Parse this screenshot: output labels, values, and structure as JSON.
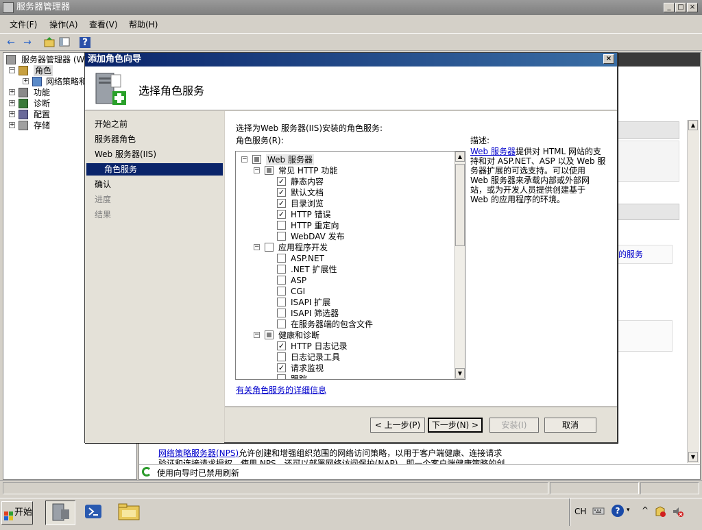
{
  "window": {
    "title": "服务器管理器",
    "controls": {
      "minimize": "_",
      "maximize": "□",
      "close": "×"
    }
  },
  "menu": [
    "文件(F)",
    "操作(A)",
    "查看(V)",
    "帮助(H)"
  ],
  "toolbar": {
    "back": "←",
    "forward": "→",
    "help": "?"
  },
  "tree": {
    "root": "服务器管理器 (W",
    "items": [
      {
        "label": "角色",
        "expander": "−",
        "selected": true
      },
      {
        "label": "网络策略和",
        "expander": "+"
      },
      {
        "label": "功能",
        "expander": "+"
      },
      {
        "label": "诊断",
        "expander": "+"
      },
      {
        "label": "配置",
        "expander": "+"
      },
      {
        "label": "存储",
        "expander": "+"
      }
    ]
  },
  "right_pane": {
    "link_fragment": "的服务",
    "description_link": "网络策略服务器(NPS)",
    "description_line1": "允许创建和增强组织范围的网络访问策略，以用于客户端健康、连接请求",
    "description_line2": "验证和连接请求授权。使用 NPS，还可以部署网络访问保护(NAP)，即一个客户端健康策略的创",
    "refresh_status": "使用向导时已禁用刷新"
  },
  "dialog": {
    "title": "添加角色向导",
    "close": "×",
    "heading": "选择角色服务",
    "nav": [
      {
        "label": "开始之前",
        "state": "normal"
      },
      {
        "label": "服务器角色",
        "state": "normal"
      },
      {
        "label": "Web 服务器(IIS)",
        "state": "normal"
      },
      {
        "label": "角色服务",
        "state": "active"
      },
      {
        "label": "确认",
        "state": "normal"
      },
      {
        "label": "进度",
        "state": "disabled"
      },
      {
        "label": "结果",
        "state": "disabled"
      }
    ],
    "instruction": "选择为Web 服务器(IIS)安装的角色服务:",
    "list_label": "角色服务(R):",
    "description_label": "描述:",
    "description_link": "Web 服务器",
    "description_lines": [
      "提供对 HTML 网站的支",
      "持和对 ASP.NET、ASP 以及 Web 服",
      "务器扩展的可选支持。可以使用",
      "Web 服务器来承载内部或外部网",
      "站，或为开发人员提供创建基于",
      "Web 的应用程序的环境。"
    ],
    "more_info_link": "有关角色服务的详细信息",
    "services": [
      {
        "label": "Web 服务器",
        "level": 0,
        "state": "partial",
        "expander": "−"
      },
      {
        "label": "常见 HTTP 功能",
        "level": 1,
        "state": "partial",
        "expander": "−"
      },
      {
        "label": "静态内容",
        "level": 2,
        "state": "checked"
      },
      {
        "label": "默认文档",
        "level": 2,
        "state": "checked"
      },
      {
        "label": "目录浏览",
        "level": 2,
        "state": "checked"
      },
      {
        "label": "HTTP 错误",
        "level": 2,
        "state": "checked"
      },
      {
        "label": "HTTP 重定向",
        "level": 2,
        "state": "unchecked"
      },
      {
        "label": "WebDAV 发布",
        "level": 2,
        "state": "unchecked"
      },
      {
        "label": "应用程序开发",
        "level": 1,
        "state": "unchecked",
        "expander": "−"
      },
      {
        "label": "ASP.NET",
        "level": 2,
        "state": "unchecked"
      },
      {
        "label": ".NET 扩展性",
        "level": 2,
        "state": "unchecked"
      },
      {
        "label": "ASP",
        "level": 2,
        "state": "unchecked"
      },
      {
        "label": "CGI",
        "level": 2,
        "state": "unchecked"
      },
      {
        "label": "ISAPI 扩展",
        "level": 2,
        "state": "unchecked"
      },
      {
        "label": "ISAPI 筛选器",
        "level": 2,
        "state": "unchecked"
      },
      {
        "label": "在服务器端的包含文件",
        "level": 2,
        "state": "unchecked"
      },
      {
        "label": "健康和诊断",
        "level": 1,
        "state": "partial",
        "expander": "−"
      },
      {
        "label": "HTTP 日志记录",
        "level": 2,
        "state": "checked"
      },
      {
        "label": "日志记录工具",
        "level": 2,
        "state": "unchecked"
      },
      {
        "label": "请求监视",
        "level": 2,
        "state": "checked"
      },
      {
        "label": "跟踪",
        "level": 2,
        "state": "unchecked"
      }
    ],
    "buttons": {
      "prev": "< 上一步(P)",
      "next": "下一步(N) >",
      "install": "安装(I)",
      "cancel": "取消"
    }
  },
  "taskbar": {
    "start": "开始",
    "lang": "CH",
    "tray_up": "^"
  }
}
